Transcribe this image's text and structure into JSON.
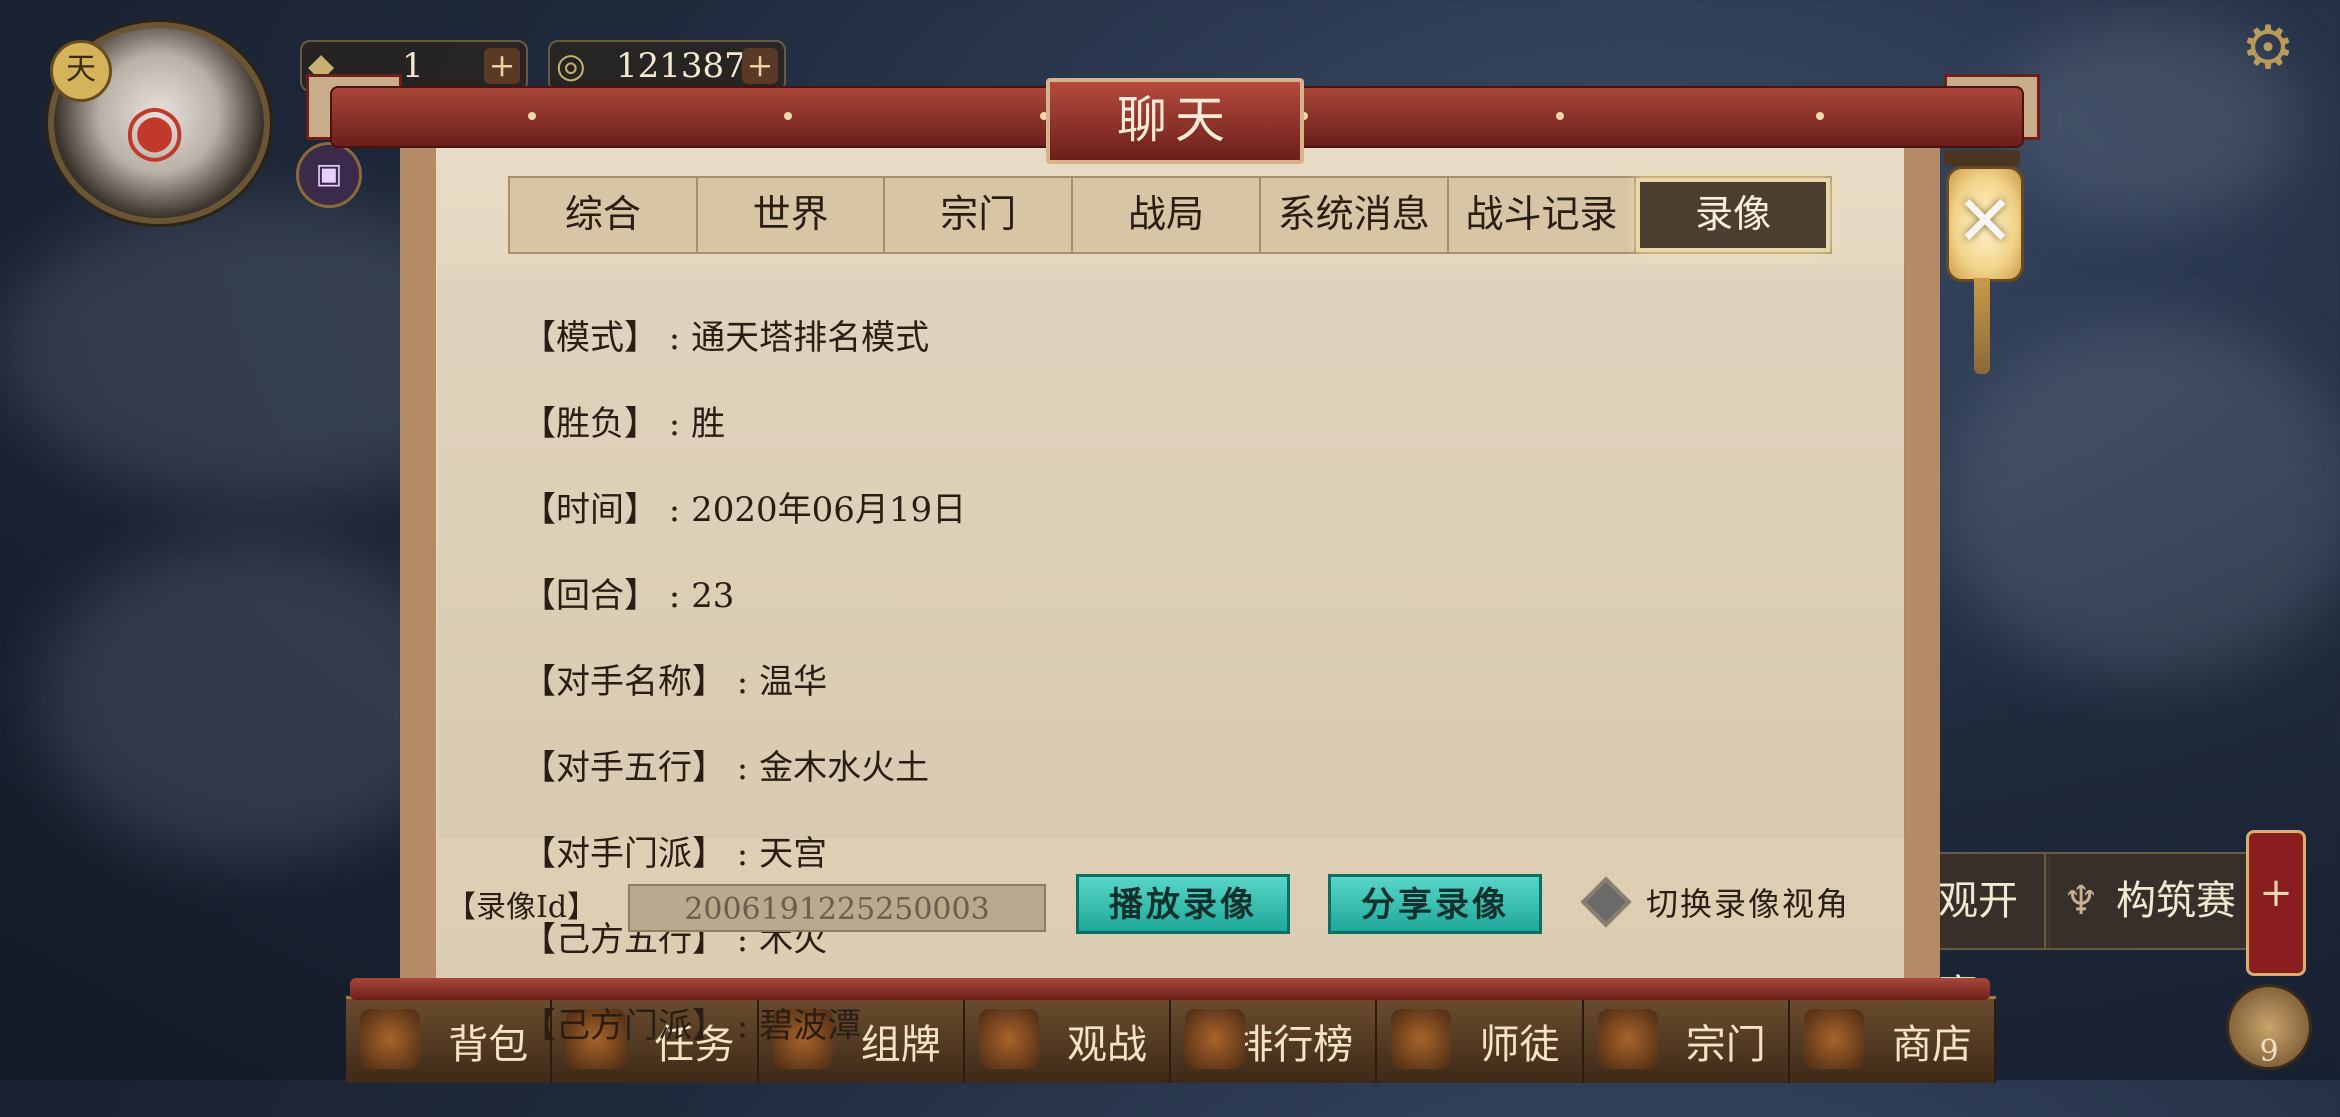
{
  "hud": {
    "avatar_badge": "天",
    "currency_1": "1",
    "currency_2": "121387",
    "event_1": "观开赛",
    "event_2": "构筑赛",
    "side_plus": "+",
    "round_badge": "9"
  },
  "dialog": {
    "title": "聊天",
    "tabs": [
      {
        "label": "综合"
      },
      {
        "label": "世界"
      },
      {
        "label": "宗门"
      },
      {
        "label": "战局"
      },
      {
        "label": "系统消息"
      },
      {
        "label": "战斗记录"
      },
      {
        "label": "录像"
      }
    ],
    "active_tab": "录像",
    "record": [
      {
        "key": "【模式】",
        "value": "通天塔排名模式"
      },
      {
        "key": "【胜负】",
        "value": "胜"
      },
      {
        "key": "【时间】",
        "value": "2020年06月19日"
      },
      {
        "key": "【回合】",
        "value": "23"
      },
      {
        "key": "【对手名称】",
        "value": "温华"
      },
      {
        "key": "【对手五行】",
        "value": "金木水火土"
      },
      {
        "key": "【对手门派】",
        "value": "天宫"
      },
      {
        "key": "【己方五行】",
        "value": "木火"
      },
      {
        "key": "【己方门派】",
        "value": "碧波潭"
      }
    ],
    "footer": {
      "id_label": "【录像Id】",
      "id_value": "2006191225250003",
      "play_button": "播放录像",
      "share_button": "分享录像",
      "toggle_label": "切换录像视角"
    },
    "close_icon": "close-icon"
  },
  "bottom_nav": [
    {
      "label": "背包"
    },
    {
      "label": "任务"
    },
    {
      "label": "组牌"
    },
    {
      "label": "观战"
    },
    {
      "label": "排行榜"
    },
    {
      "label": "师徒"
    },
    {
      "label": "宗门"
    },
    {
      "label": "商店"
    }
  ],
  "colors": {
    "accent_red": "#8a2a22",
    "button_teal": "#2fc0b0",
    "parchment": "#e4d6bd"
  }
}
